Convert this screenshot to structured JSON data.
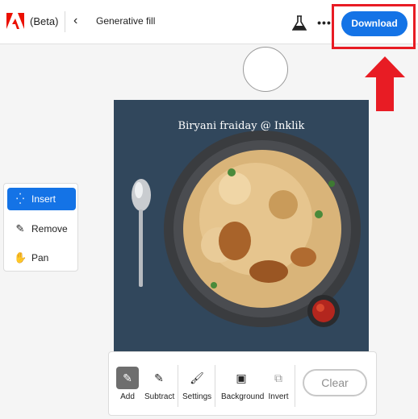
{
  "header": {
    "beta_label": "(Beta)",
    "back_icon": "chevron-left-icon",
    "title": "Generative fill",
    "labs_icon": "flask-icon",
    "more_icon": "more-icon",
    "more_glyph": "•••",
    "download_label": "Download"
  },
  "annotation": {
    "highlight_color": "#e81c24",
    "arrow_color": "#e81c24"
  },
  "canvas": {
    "text": "Biryani fraiday @ Inklik",
    "background_color": "#31475c"
  },
  "tools": [
    {
      "label": "Insert",
      "icon": "insert-sparkle-icon",
      "glyph": "⁛",
      "active": true
    },
    {
      "label": "Remove",
      "icon": "remove-eraser-icon",
      "glyph": "✎",
      "active": false
    },
    {
      "label": "Pan",
      "icon": "hand-icon",
      "glyph": "✋",
      "active": false
    }
  ],
  "bottom_toolbar": {
    "add": {
      "label": "Add",
      "icon": "brush-add-icon",
      "glyph": "✎"
    },
    "subtract": {
      "label": "Subtract",
      "icon": "brush-subtract-icon",
      "glyph": "✎"
    },
    "settings": {
      "label": "Settings",
      "icon": "brush-icon",
      "glyph": "🖌"
    },
    "background": {
      "label": "Background",
      "icon": "image-icon",
      "glyph": "▣"
    },
    "invert": {
      "label": "Invert",
      "icon": "invert-icon",
      "glyph": "⧉"
    },
    "clear_label": "Clear"
  },
  "colors": {
    "accent": "#1473e6",
    "adobe_red": "#eb1000"
  }
}
